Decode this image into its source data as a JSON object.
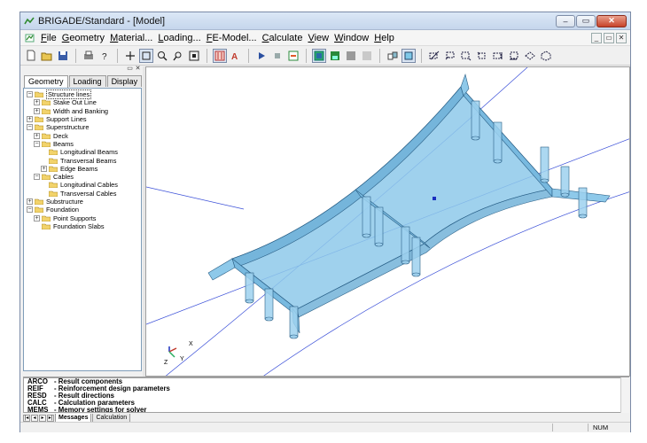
{
  "window": {
    "title": "BRIGADE/Standard - [Model]",
    "buttons": {
      "minimize": "–",
      "maximize": "▭",
      "close": "✕"
    }
  },
  "menu": {
    "items": [
      {
        "key": "F",
        "rest": "ile"
      },
      {
        "key": "G",
        "rest": "eometry"
      },
      {
        "key": "M",
        "rest": "aterial..."
      },
      {
        "key": "L",
        "rest": "oading..."
      },
      {
        "key": "F",
        "rest": "E-Model..."
      },
      {
        "key": "C",
        "rest": "alculate"
      },
      {
        "key": "V",
        "rest": "iew"
      },
      {
        "key": "W",
        "rest": "indow"
      },
      {
        "key": "H",
        "rest": "elp"
      }
    ],
    "mdi_buttons": [
      "_",
      "▭",
      "✕"
    ]
  },
  "panel": {
    "header_buttons": [
      "▭",
      "✕"
    ],
    "tabs": [
      "Geometry",
      "Loading",
      "Display"
    ],
    "active_tab": "Geometry",
    "tree": [
      {
        "label": "Structure lines",
        "level": 0,
        "exp": "−",
        "selected": true
      },
      {
        "label": "Stake Out Line",
        "level": 1,
        "exp": "+"
      },
      {
        "label": "Width and Banking",
        "level": 1,
        "exp": "+"
      },
      {
        "label": "Support Lines",
        "level": 0,
        "exp": "+"
      },
      {
        "label": "Superstructure",
        "level": 0,
        "exp": "−"
      },
      {
        "label": "Deck",
        "level": 1,
        "exp": "+"
      },
      {
        "label": "Beams",
        "level": 1,
        "exp": "−"
      },
      {
        "label": "Longitudinal Beams",
        "level": 2,
        "exp": ""
      },
      {
        "label": "Transversal Beams",
        "level": 2,
        "exp": ""
      },
      {
        "label": "Edge Beams",
        "level": 2,
        "exp": "+"
      },
      {
        "label": "Cables",
        "level": 1,
        "exp": "−"
      },
      {
        "label": "Longitudinal Cables",
        "level": 2,
        "exp": ""
      },
      {
        "label": "Transversal Cables",
        "level": 2,
        "exp": ""
      },
      {
        "label": "Substructure",
        "level": 0,
        "exp": "+"
      },
      {
        "label": "Foundation",
        "level": 0,
        "exp": "−"
      },
      {
        "label": "Point Supports",
        "level": 1,
        "exp": "+"
      },
      {
        "label": "Foundation Slabs",
        "level": 1,
        "exp": ""
      }
    ]
  },
  "axis": {
    "x": "X",
    "y": "Y",
    "z": "Z"
  },
  "console": {
    "commands": [
      {
        "code": "ARCO",
        "desc": "- Result components"
      },
      {
        "code": "REIF",
        "desc": "- Reinforcement design parameters"
      },
      {
        "code": "RESD",
        "desc": "- Result directions"
      },
      {
        "code": "CALC",
        "desc": "- Calculation parameters"
      },
      {
        "code": "MEMS",
        "desc": "- Memory settings for solver"
      }
    ],
    "nav": [
      "|◂",
      "◂",
      "▸",
      "▸|"
    ],
    "tabs": [
      "Messages",
      "Calculation"
    ],
    "active_tab": "Messages"
  },
  "status": {
    "num": "NUM"
  },
  "colors": {
    "deck_fill": "#8ec9ea",
    "deck_stroke": "#2a5f86",
    "guide_line": "#3a4fd8",
    "column": "#9ed1ee"
  }
}
